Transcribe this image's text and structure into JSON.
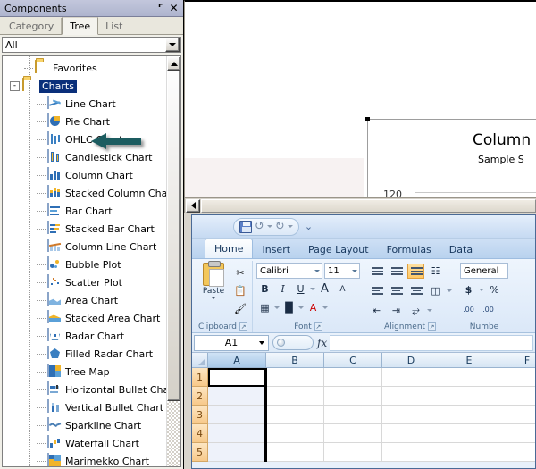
{
  "panel": {
    "title": "Components",
    "pin_icon": "pin-icon",
    "close_icon": "close-icon",
    "tabs": [
      {
        "label": "Category",
        "active": false
      },
      {
        "label": "Tree",
        "active": true
      },
      {
        "label": "List",
        "active": false
      }
    ],
    "filter_dropdown": {
      "value": "All",
      "icon": "chevron-down-icon"
    },
    "tree": [
      {
        "label": "Favorites",
        "icon": "folder-icon",
        "type": "folder",
        "depth": 1,
        "expander": "",
        "selected": false
      },
      {
        "label": "Charts",
        "icon": "folder-icon",
        "type": "folder",
        "depth": 0,
        "expander": "-",
        "selected": true
      },
      {
        "label": "Line Chart",
        "icon": "line-chart-icon",
        "type": "leaf",
        "depth": 2,
        "expander": "",
        "selected": false
      },
      {
        "label": "Pie Chart",
        "icon": "pie-chart-icon",
        "type": "leaf",
        "depth": 2,
        "expander": "",
        "selected": false
      },
      {
        "label": "OHLC Chart",
        "icon": "ohlc-chart-icon",
        "type": "leaf",
        "depth": 2,
        "expander": "",
        "selected": false
      },
      {
        "label": "Candlestick Chart",
        "icon": "candlestick-chart-icon",
        "type": "leaf",
        "depth": 2,
        "expander": "",
        "selected": false
      },
      {
        "label": "Column Chart",
        "icon": "column-chart-icon",
        "type": "leaf",
        "depth": 2,
        "expander": "",
        "selected": false
      },
      {
        "label": "Stacked Column Chart",
        "icon": "stacked-column-chart-icon",
        "type": "leaf",
        "depth": 2,
        "expander": "",
        "selected": false
      },
      {
        "label": "Bar Chart",
        "icon": "bar-chart-icon",
        "type": "leaf",
        "depth": 2,
        "expander": "",
        "selected": false
      },
      {
        "label": "Stacked Bar Chart",
        "icon": "stacked-bar-chart-icon",
        "type": "leaf",
        "depth": 2,
        "expander": "",
        "selected": false
      },
      {
        "label": "Column Line Chart",
        "icon": "column-line-chart-icon",
        "type": "leaf",
        "depth": 2,
        "expander": "",
        "selected": false
      },
      {
        "label": "Bubble Plot",
        "icon": "bubble-plot-icon",
        "type": "leaf",
        "depth": 2,
        "expander": "",
        "selected": false
      },
      {
        "label": "Scatter Plot",
        "icon": "scatter-plot-icon",
        "type": "leaf",
        "depth": 2,
        "expander": "",
        "selected": false
      },
      {
        "label": "Area Chart",
        "icon": "area-chart-icon",
        "type": "leaf",
        "depth": 2,
        "expander": "",
        "selected": false
      },
      {
        "label": "Stacked Area Chart",
        "icon": "stacked-area-chart-icon",
        "type": "leaf",
        "depth": 2,
        "expander": "",
        "selected": false
      },
      {
        "label": "Radar Chart",
        "icon": "radar-chart-icon",
        "type": "leaf",
        "depth": 2,
        "expander": "",
        "selected": false
      },
      {
        "label": "Filled Radar Chart",
        "icon": "filled-radar-chart-icon",
        "type": "leaf",
        "depth": 2,
        "expander": "",
        "selected": false
      },
      {
        "label": "Tree Map",
        "icon": "tree-map-icon",
        "type": "leaf",
        "depth": 2,
        "expander": "",
        "selected": false
      },
      {
        "label": "Horizontal Bullet Chart",
        "icon": "horizontal-bullet-chart-icon",
        "type": "leaf",
        "depth": 2,
        "expander": "",
        "selected": false
      },
      {
        "label": "Vertical Bullet Chart",
        "icon": "vertical-bullet-chart-icon",
        "type": "leaf",
        "depth": 2,
        "expander": "",
        "selected": false
      },
      {
        "label": "Sparkline Chart",
        "icon": "sparkline-chart-icon",
        "type": "leaf",
        "depth": 2,
        "expander": "",
        "selected": false
      },
      {
        "label": "Waterfall Chart",
        "icon": "waterfall-chart-icon",
        "type": "leaf",
        "depth": 2,
        "expander": "",
        "selected": false
      },
      {
        "label": "Marimekko Chart",
        "icon": "marimekko-chart-icon",
        "type": "leaf",
        "depth": 2,
        "expander": "",
        "selected": false
      }
    ],
    "annotation_arrow": {
      "name": "charts-callout-arrow",
      "color": "#1a5c60",
      "points_to": "Charts"
    },
    "scrollbar": {
      "up_icon": "scroll-up-icon"
    }
  },
  "preview": {
    "chart_title": "Column",
    "chart_subtitle": "Sample S",
    "axis_tick": "120",
    "scroll_left_icon": "scroll-left-icon"
  },
  "excel": {
    "quick_access": {
      "save_icon": "save-icon",
      "undo_icon": "undo-icon",
      "redo_icon": "redo-icon",
      "customize_icon": "customize-qat-icon"
    },
    "ribbon_tabs": [
      {
        "label": "Home",
        "active": true
      },
      {
        "label": "Insert",
        "active": false
      },
      {
        "label": "Page Layout",
        "active": false
      },
      {
        "label": "Formulas",
        "active": false
      },
      {
        "label": "Data",
        "active": false
      }
    ],
    "groups": {
      "clipboard": {
        "label": "Clipboard",
        "paste_label": "Paste",
        "paste_icon": "paste-icon",
        "cut_icon": "cut-icon",
        "copy_icon": "copy-icon",
        "format_painter_icon": "format-painter-icon",
        "launcher_icon": "dialog-launcher-icon"
      },
      "font": {
        "label": "Font",
        "font_name": "Calibri",
        "font_size": "11",
        "bold_label": "B",
        "italic_label": "I",
        "underline_label": "U",
        "grow_font_label": "A",
        "shrink_font_label": "A",
        "borders_icon": "borders-icon",
        "fill_color_icon": "fill-color-icon",
        "font_color_label": "A",
        "launcher_icon": "dialog-launcher-icon"
      },
      "alignment": {
        "label": "Alignment",
        "top_align_icon": "align-top-icon",
        "middle_align_icon": "align-middle-icon",
        "bottom_align_icon": "align-bottom-icon",
        "orientation_icon": "orientation-icon",
        "align_left_icon": "align-left-icon",
        "align_center_icon": "align-center-icon",
        "align_right_icon": "align-right-icon",
        "merge_center_icon": "merge-center-icon",
        "decrease_indent_icon": "decrease-indent-icon",
        "increase_indent_icon": "increase-indent-icon",
        "wrap_text_icon": "wrap-text-icon",
        "launcher_icon": "dialog-launcher-icon"
      },
      "number": {
        "label": "Numbe",
        "format_value": "General",
        "currency_label": "$",
        "percent_label": "%",
        "increase_decimal_icon": "increase-decimal-icon",
        "decrease_decimal_icon": "decrease-decimal-icon"
      }
    },
    "formula_bar": {
      "name_box": "A1",
      "fx_label": "fx",
      "input_value": "",
      "dropdown_icon": "chevron-down-icon"
    },
    "grid": {
      "columns": [
        "A",
        "B",
        "C",
        "D",
        "E",
        "F"
      ],
      "selected_column": "A",
      "rows": [
        "1",
        "2",
        "3",
        "4",
        "5"
      ],
      "active_cell": "A1"
    }
  }
}
